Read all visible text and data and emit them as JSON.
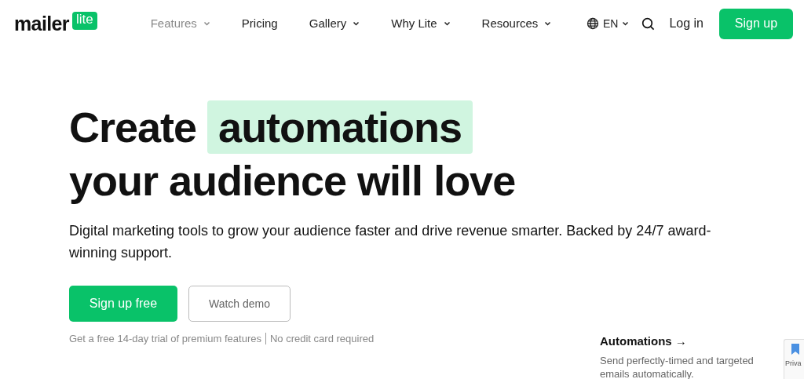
{
  "logo": {
    "word": "mailer",
    "badge": "lite"
  },
  "nav": [
    {
      "label": "Features",
      "dropdown": true,
      "selected": true
    },
    {
      "label": "Pricing",
      "dropdown": false,
      "selected": false
    },
    {
      "label": "Gallery",
      "dropdown": true,
      "selected": false
    },
    {
      "label": "Why Lite",
      "dropdown": true,
      "selected": false
    },
    {
      "label": "Resources",
      "dropdown": true,
      "selected": false
    }
  ],
  "language": "EN",
  "login": "Log in",
  "signup": "Sign up",
  "hero": {
    "title_start": "Create",
    "title_highlight": "automations",
    "title_end": "your audience will love",
    "subtitle": "Digital marketing tools to grow your audience faster and drive revenue smarter. Backed by 24/7 award-winning support.",
    "primary_button": "Sign up free",
    "secondary_button": "Watch demo",
    "note": "Get a free 14-day trial of premium features",
    "note_2": "No credit card required"
  },
  "feature": {
    "title": "Automations →",
    "description": "Send perfectly-timed and targeted emails automatically."
  },
  "privacy_badge": "Priva"
}
